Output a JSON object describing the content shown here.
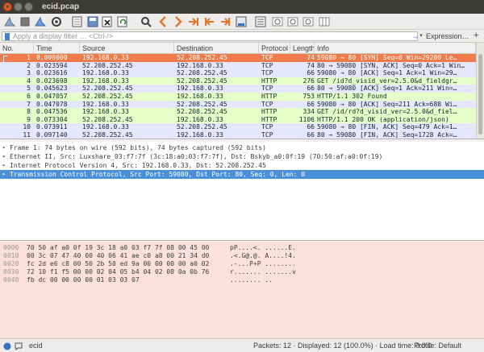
{
  "window": {
    "title": "ecid.pcap"
  },
  "filter": {
    "placeholder": "Apply a display filter … <Ctrl-/>",
    "arrow": "→",
    "expression_label": "Expression…",
    "plus_label": "+"
  },
  "packet_list": {
    "columns": [
      "No.",
      "Time",
      "Source",
      "Destination",
      "Protocol",
      "Length",
      "Info"
    ],
    "rows": [
      {
        "no": "1",
        "time": "0.000000",
        "src": "192.168.0.33",
        "dst": "52.208.252.45",
        "proto": "TCP",
        "len": "74",
        "info": "59080 → 80 [SYN] Seq=0 Win=29200 Le…",
        "kind": "selected"
      },
      {
        "no": "2",
        "time": "0.023594",
        "src": "52.208.252.45",
        "dst": "192.168.0.33",
        "proto": "TCP",
        "len": "74",
        "info": "80 → 59080 [SYN, ACK] Seq=0 Ack=1 Win…",
        "kind": "tcp"
      },
      {
        "no": "3",
        "time": "0.023616",
        "src": "192.168.0.33",
        "dst": "52.208.252.45",
        "proto": "TCP",
        "len": "66",
        "info": "59080 → 80 [ACK] Seq=1 Ack=1 Win=29…",
        "kind": "tcp"
      },
      {
        "no": "4",
        "time": "0.023698",
        "src": "192.168.0.33",
        "dst": "52.208.252.45",
        "proto": "HTTP",
        "len": "276",
        "info": "GET /id?d_visid_ver=2.5.0&d_fieldgr…",
        "kind": "http"
      },
      {
        "no": "5",
        "time": "0.045623",
        "src": "52.208.252.45",
        "dst": "192.168.0.33",
        "proto": "TCP",
        "len": "66",
        "info": "80 → 59080 [ACK] Seq=1 Ack=211 Win=…",
        "kind": "tcp"
      },
      {
        "no": "6",
        "time": "0.047057",
        "src": "52.208.252.45",
        "dst": "192.168.0.33",
        "proto": "HTTP",
        "len": "753",
        "info": "HTTP/1.1 302 Found",
        "kind": "http"
      },
      {
        "no": "7",
        "time": "0.047078",
        "src": "192.168.0.33",
        "dst": "52.208.252.45",
        "proto": "TCP",
        "len": "66",
        "info": "59080 → 80 [ACK] Seq=211 Ack=688 Wi…",
        "kind": "tcp"
      },
      {
        "no": "8",
        "time": "0.047536",
        "src": "192.168.0.33",
        "dst": "52.208.252.45",
        "proto": "HTTP",
        "len": "334",
        "info": "GET /id/rd?d_visid_ver=2.5.0&d_fiel…",
        "kind": "http"
      },
      {
        "no": "9",
        "time": "0.073304",
        "src": "52.208.252.45",
        "dst": "192.168.0.33",
        "proto": "HTTP",
        "len": "1106",
        "info": "HTTP/1.1 200 OK  (application/json)",
        "kind": "http"
      },
      {
        "no": "10",
        "time": "0.073911",
        "src": "192.168.0.33",
        "dst": "52.208.252.45",
        "proto": "TCP",
        "len": "66",
        "info": "59080 → 80 [FIN, ACK] Seq=479 Ack=1…",
        "kind": "tcp"
      },
      {
        "no": "11",
        "time": "0.097140",
        "src": "52.208.252.45",
        "dst": "192.168.0.33",
        "proto": "TCP",
        "len": "66",
        "info": "80 → 59080 [FIN, ACK] Seq=1728 Ack=…",
        "kind": "tcp"
      }
    ]
  },
  "details": [
    {
      "arrow": "▸",
      "text": "Frame 1: 74 bytes on wire (592 bits), 74 bytes captured (592 bits)",
      "selected": false
    },
    {
      "arrow": "▸",
      "text": "Ethernet II, Src: Luxshare_03:f7:7f (3c:18:a0:03:f7:7f), Dst: Bskyb_a0:0f:19 (70:50:af:a0:0f:19)",
      "selected": false
    },
    {
      "arrow": "▸",
      "text": "Internet Protocol Version 4, Src: 192.168.0.33, Dst: 52.208.252.45",
      "selected": false
    },
    {
      "arrow": "▸",
      "text": "Transmission Control Protocol, Src Port: 59080, Dst Port: 80, Seq: 0, Len: 0",
      "selected": true
    }
  ],
  "hex": [
    {
      "offset": "0000",
      "bytes": "70 50 af a0 0f 19 3c 18  a0 03 f7 7f 08 00 45 00",
      "ascii": "pP....<. ......E."
    },
    {
      "offset": "0010",
      "bytes": "00 3c 07 47 40 00 40 06  41 ae c0 a8 00 21 34 d0",
      "ascii": ".<.G@.@. A....!4."
    },
    {
      "offset": "0020",
      "bytes": "fc 2d e6 c8 00 50 2b 50  ed 9a 00 00 00 00 a0 02",
      "ascii": ".-...P+P ........"
    },
    {
      "offset": "0030",
      "bytes": "72 10 f1 f5 00 00 02 04  05 b4 04 02 08 0a 0b 76",
      "ascii": "r....... .......v"
    },
    {
      "offset": "0040",
      "bytes": "fb dc 00 00 00 00 01 03  03 07",
      "ascii": "........ .."
    }
  ],
  "status": {
    "file": "ecid",
    "stats": "Packets: 12 · Displayed: 12 (100.0%) · Load time: 0:0.0",
    "profile": "Profile: Default"
  },
  "colors": {
    "selected_row": "#f17b4a",
    "tcp_row": "#e7e6ff",
    "http_row": "#e4ffc7",
    "detail_selected": "#4a90d9",
    "hex_bg": "#fbe1d9"
  }
}
